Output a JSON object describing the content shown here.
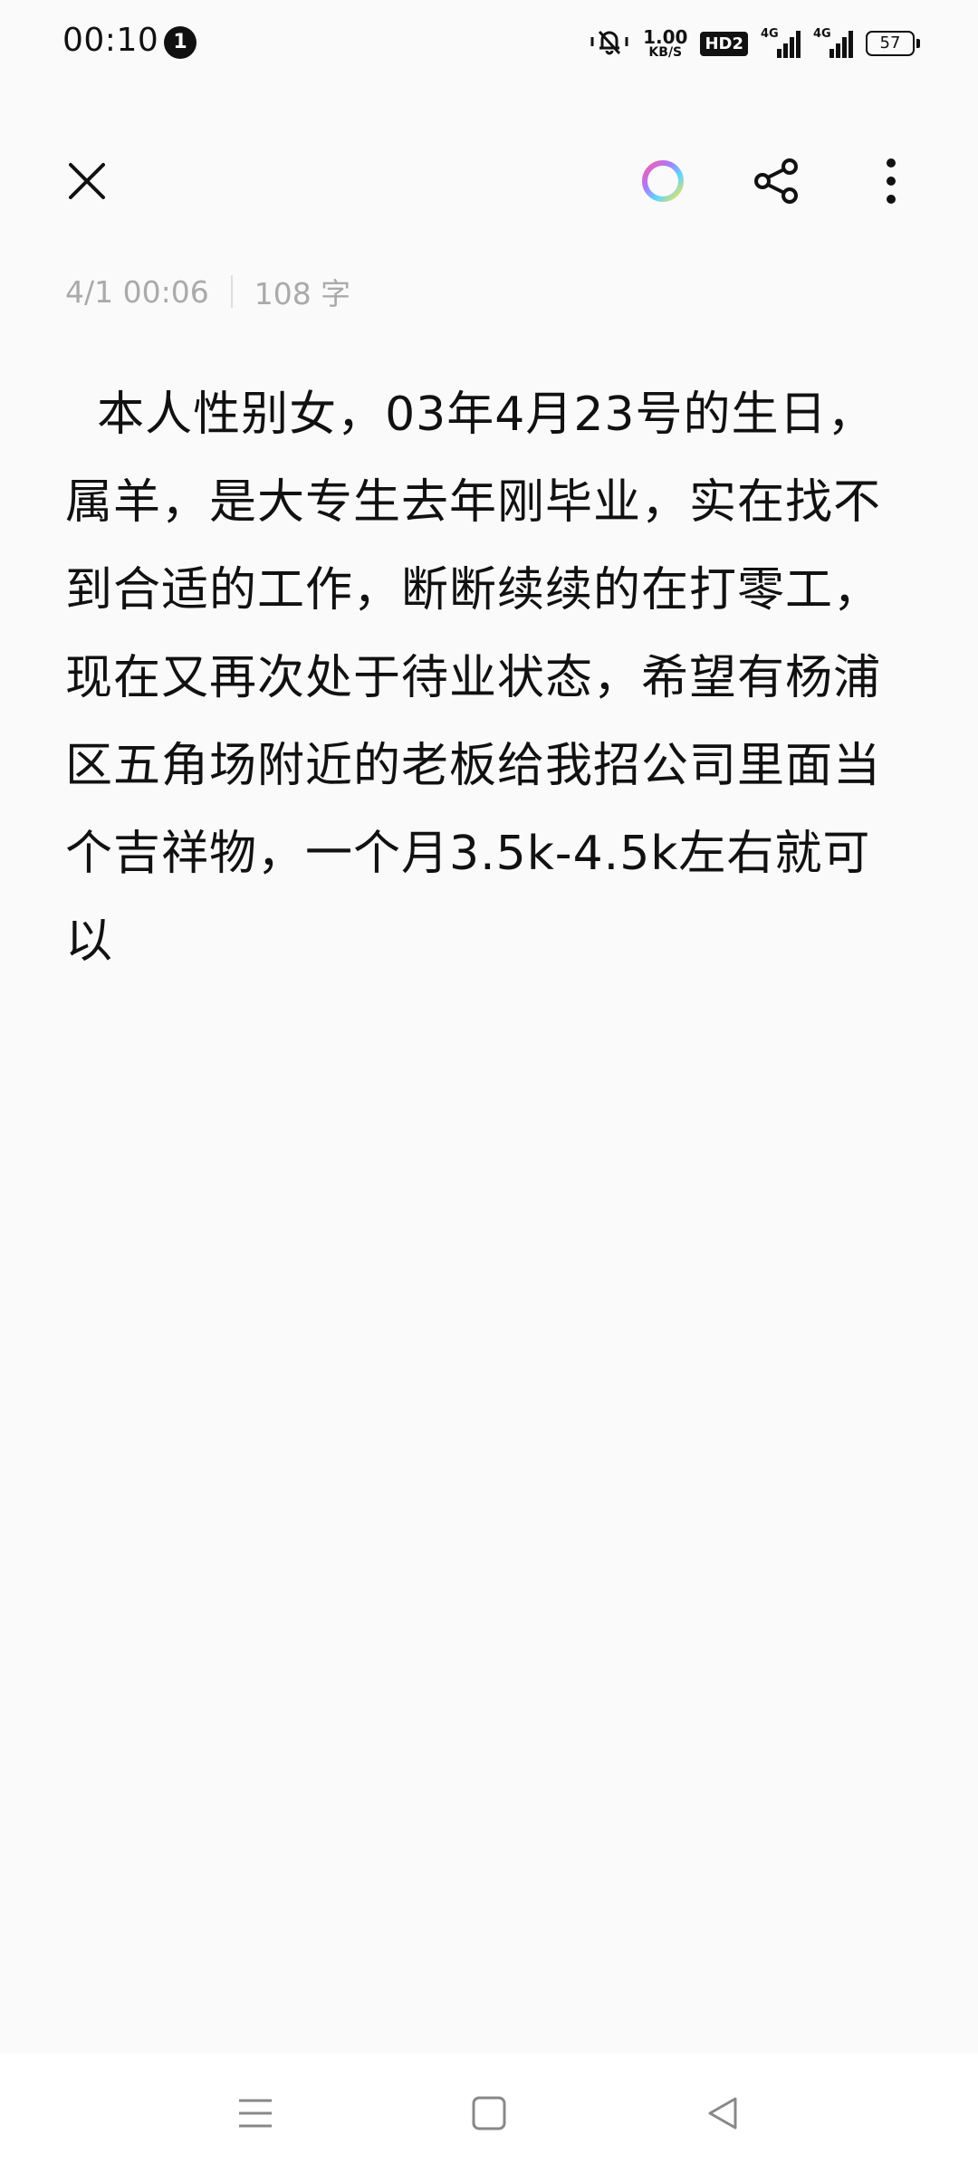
{
  "status_bar": {
    "time": "00:10",
    "notification_count": "1",
    "net_speed_value": "1.00",
    "net_speed_unit": "KB/S",
    "hd_label": "HD2",
    "signal1_label": "4G",
    "signal2_label": "4G",
    "battery_level": "57",
    "icons": [
      "mute-vibrate-icon",
      "signal-icon",
      "signal-icon",
      "battery-icon"
    ]
  },
  "toolbar": {
    "icons": [
      "close-icon",
      "color-palette-icon",
      "share-icon",
      "more-vert-icon"
    ]
  },
  "meta": {
    "date": "4/1 00:06",
    "word_count": "108 字"
  },
  "note": {
    "text": "  本人性别女，03年4月23号的生日，属羊，是大专生去年刚毕业，实在找不到合适的工作，断断续续的在打零工，现在又再次处于待业状态，希望有杨浦区五角场附近的老板给我招公司里面当个吉祥物，一个月3.5k-4.5k左右就可以"
  },
  "nav_bar": {
    "icons": [
      "menu-icon",
      "home-icon",
      "back-icon"
    ]
  },
  "colors": {
    "background": "#fafafa",
    "text": "#111111",
    "meta_text": "#aaaaaa",
    "nav_background": "#ffffff"
  }
}
